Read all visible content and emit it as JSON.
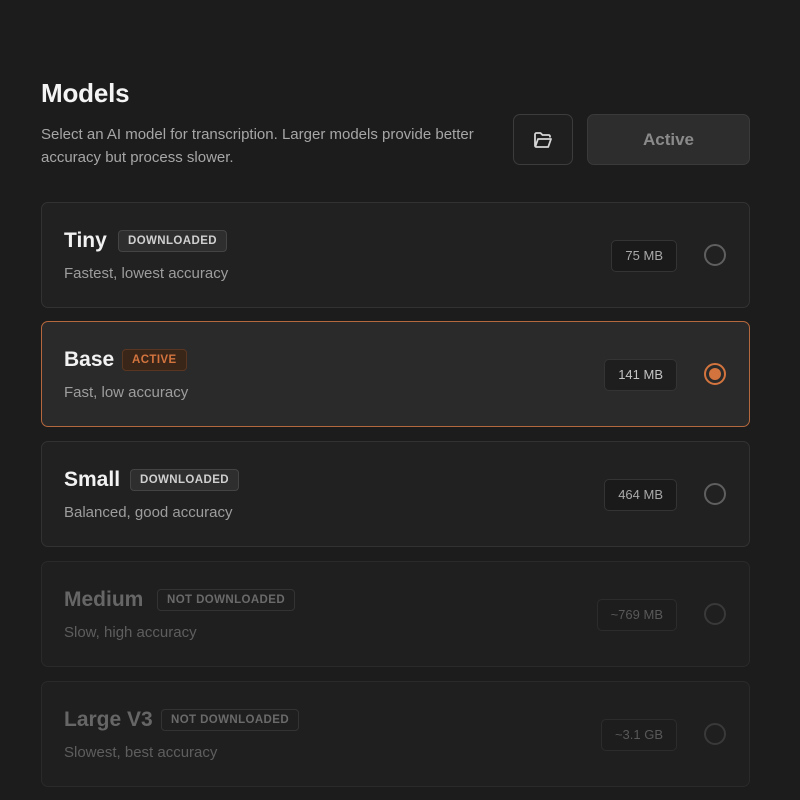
{
  "header": {
    "title": "Models",
    "subtitle": "Select an AI model for transcription. Larger models provide better accuracy but process slower.",
    "folder_icon": "folder-open-icon",
    "active_button_label": "Active"
  },
  "colors": {
    "accent": "#d3743e",
    "background": "#1c1c1c",
    "card": "#212121"
  },
  "models": [
    {
      "name": "Tiny",
      "badge": "DOWNLOADED",
      "status": "downloaded",
      "description": "Fastest, lowest accuracy",
      "size": "75 MB",
      "selected": false
    },
    {
      "name": "Base",
      "badge": "ACTIVE",
      "status": "active",
      "description": "Fast, low accuracy",
      "size": "141 MB",
      "selected": true
    },
    {
      "name": "Small",
      "badge": "DOWNLOADED",
      "status": "downloaded",
      "description": "Balanced, good accuracy",
      "size": "464 MB",
      "selected": false
    },
    {
      "name": "Medium",
      "badge": "NOT DOWNLOADED",
      "status": "not-downloaded",
      "description": "Slow, high accuracy",
      "size": "~769 MB",
      "selected": false
    },
    {
      "name": "Large V3",
      "badge": "NOT DOWNLOADED",
      "status": "not-downloaded",
      "description": "Slowest, best accuracy",
      "size": "~3.1 GB",
      "selected": false
    }
  ]
}
